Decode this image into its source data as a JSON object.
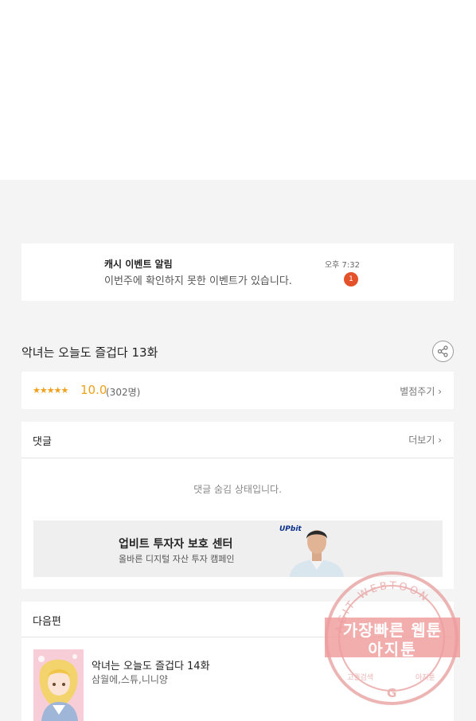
{
  "notification": {
    "title": "캐시 이벤트 알림",
    "message": "이번주에 확인하지 못한 이벤트가 있습니다.",
    "time": "오후 7:32",
    "badge": "1"
  },
  "episode": {
    "title": "악녀는 오늘도 즐겁다 13화",
    "share_icon": "share-icon"
  },
  "rating": {
    "stars": "★★★★★",
    "score": "10.0",
    "count": "(302명)",
    "rate_label": "별점주기 ›"
  },
  "comments": {
    "title": "댓글",
    "more_label": "더보기 ›",
    "hidden_message": "댓글 숨김 상태입니다."
  },
  "banner": {
    "title": "업비트 투자자 보호 센터",
    "subtitle": "올바른 디지털 자산 투자 캠페인",
    "logo": "UPbit"
  },
  "next_episode": {
    "header": "다음편",
    "title": "악녀는 오늘도 즐겁다 14화",
    "authors": "삼월에,스튜,니니양"
  },
  "watermark": {
    "line1": "가장빠른 웹툰",
    "line2": "아지툰",
    "ring_top": "AGIT WEBTOON",
    "ring_left": "고퀄검색",
    "ring_right": "아지툰",
    "logo": "G"
  },
  "colors": {
    "accent_star": "#f0a01a",
    "badge": "#e4522c",
    "watermark": "#e8a0a0"
  }
}
